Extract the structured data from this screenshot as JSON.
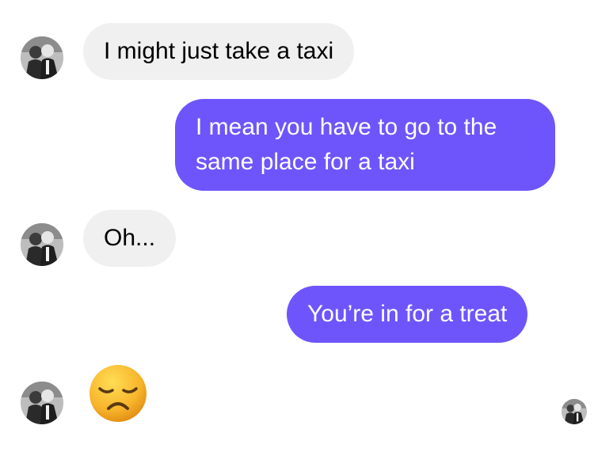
{
  "conversation": {
    "messages": [
      {
        "sender": "other",
        "text": "I might just take a taxi"
      },
      {
        "sender": "me",
        "line1": "I mean you have to go to the",
        "line2": "same place for a taxi"
      },
      {
        "sender": "other",
        "text": "Oh..."
      },
      {
        "sender": "me",
        "text": "You’re in for a treat"
      },
      {
        "sender": "other",
        "emoji": "disappointed-face"
      }
    ]
  },
  "colors": {
    "outgoing_bubble": "#6e55fb",
    "incoming_bubble": "#f0f0f0",
    "emoji_face": "#f7b52c"
  }
}
